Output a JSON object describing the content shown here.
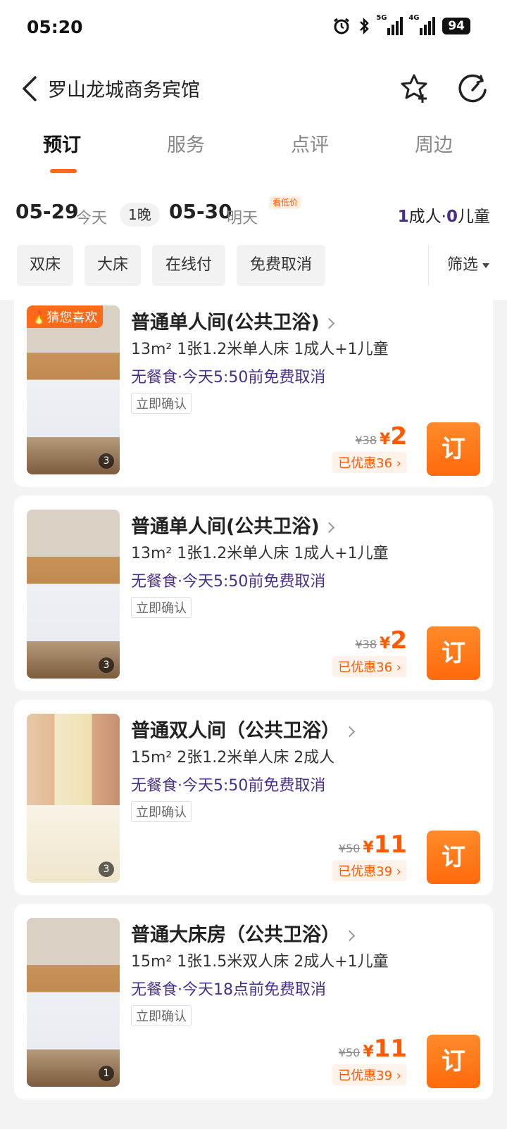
{
  "status_bar": {
    "time": "05:20",
    "network_1": "5G",
    "network_2": "4G",
    "battery": "94"
  },
  "nav": {
    "title": "罗山龙城商务宾馆"
  },
  "tabs": [
    {
      "label": "预订",
      "active": true
    },
    {
      "label": "服务",
      "active": false
    },
    {
      "label": "点评",
      "active": false
    },
    {
      "label": "周边",
      "active": false
    }
  ],
  "dates": {
    "checkin": "05-29",
    "checkin_day": "今天",
    "nights": "1晚",
    "checkout": "05-30",
    "checkout_day": "明天",
    "low_price_tag": "看低价",
    "adults_num": "1",
    "adults_label": "成人",
    "sep": "·",
    "children_num": "0",
    "children_label": "儿童"
  },
  "filters": {
    "chips": [
      "双床",
      "大床",
      "在线付",
      "免费取消"
    ],
    "filter_label": "筛选"
  },
  "rooms": [
    {
      "tag": "猜您喜欢",
      "name": "普通单人间(公共卫浴)",
      "info": "13m²  1张1.2米单人床  1成人+1儿童",
      "policy": "无餐食·今天5:50前免费取消",
      "confirm": "立即确认",
      "orig": "¥38",
      "currency": "¥",
      "price": "2",
      "discount": "已优惠36",
      "book": "订",
      "photo_count": "3"
    },
    {
      "tag": "",
      "name": "普通单人间(公共卫浴)",
      "info": "13m²  1张1.2米单人床  1成人+1儿童",
      "policy": "无餐食·今天5:50前免费取消",
      "confirm": "立即确认",
      "orig": "¥38",
      "currency": "¥",
      "price": "2",
      "discount": "已优惠36",
      "book": "订",
      "photo_count": "3"
    },
    {
      "tag": "",
      "name": "普通双人间（公共卫浴）",
      "info": "15m²  2张1.2米单人床  2成人",
      "policy": "无餐食·今天5:50前免费取消",
      "confirm": "立即确认",
      "orig": "¥50",
      "currency": "¥",
      "price": "11",
      "discount": "已优惠39",
      "book": "订",
      "photo_count": "3"
    },
    {
      "tag": "",
      "name": "普通大床房（公共卫浴）",
      "info": "15m²  1张1.5米双人床  2成人+1儿童",
      "policy": "无餐食·今天18点前免费取消",
      "confirm": "立即确认",
      "orig": "¥50",
      "currency": "¥",
      "price": "11",
      "discount": "已优惠39",
      "book": "订",
      "photo_count": "1"
    }
  ]
}
